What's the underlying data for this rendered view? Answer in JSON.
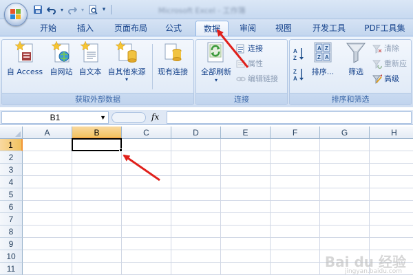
{
  "app": {
    "title_blur": "Microsoft Excel - 工作簿"
  },
  "quick_access": [
    "save-icon",
    "undo-icon",
    "redo-icon",
    "print-preview-icon"
  ],
  "tabs": [
    {
      "label": "开始",
      "active": false
    },
    {
      "label": "插入",
      "active": false
    },
    {
      "label": "页面布局",
      "active": false
    },
    {
      "label": "公式",
      "active": false
    },
    {
      "label": "数据",
      "active": true
    },
    {
      "label": "审阅",
      "active": false
    },
    {
      "label": "视图",
      "active": false
    },
    {
      "label": "开发工具",
      "active": false
    },
    {
      "label": "PDF工具集",
      "active": false
    }
  ],
  "ribbon": {
    "external_data": {
      "label": "获取外部数据",
      "buttons": [
        "自 Access",
        "自网站",
        "自文本",
        "自其他来源",
        "现有连接"
      ]
    },
    "connections": {
      "label": "连接",
      "refresh": "全部刷新",
      "connect": "连接",
      "properties": "属性",
      "edit_links": "编辑链接"
    },
    "sort_filter": {
      "label": "排序和筛选",
      "sort": "排序...",
      "filter": "筛选",
      "clear": "清除",
      "reapply": "重新应",
      "advanced": "高级"
    }
  },
  "formula_bar": {
    "name_box": "B1",
    "fx": "fx",
    "content": ""
  },
  "sheet": {
    "columns": [
      "A",
      "B",
      "C",
      "D",
      "E",
      "F",
      "G",
      "H"
    ],
    "rows": [
      "1",
      "2",
      "3",
      "4",
      "5",
      "6",
      "7",
      "8",
      "9",
      "10",
      "11"
    ],
    "selected_cell": "B1"
  },
  "watermark": {
    "text": "Bai du 经验",
    "sub": "jingyan.baidu.com"
  },
  "colors": {
    "annotation_arrow": "#e0201b",
    "selection_header": "#f1c15f",
    "ribbon_text": "#15428b"
  }
}
